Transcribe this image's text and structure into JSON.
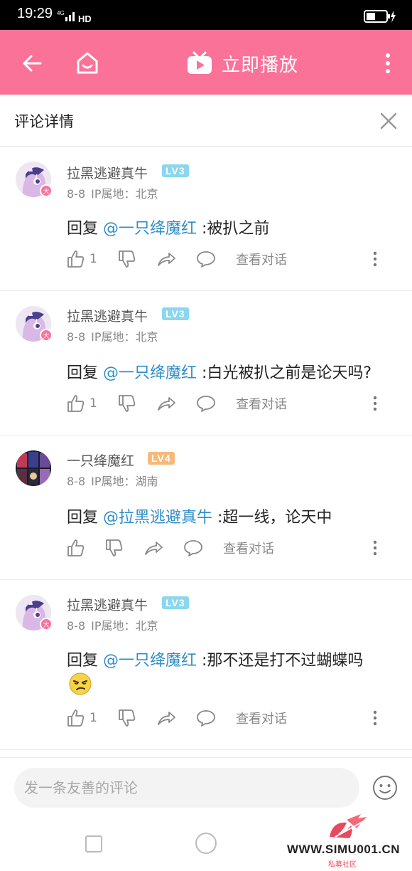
{
  "status_bar": {
    "time": "19:29",
    "network": "4G",
    "hd": "HD"
  },
  "header": {
    "play_label": "立即播放",
    "bg_color": "#fb7299"
  },
  "section": {
    "title": "评论详情"
  },
  "comments": [
    {
      "user": "拉黑逃避真牛",
      "level": "LV3",
      "date": "8-8",
      "ip": "IP属地：北京",
      "reply_prefix": "回复 ",
      "mention": "@一只绛魔红",
      "text": " :被扒之前",
      "likes": "1",
      "view_conversation": "查看对话"
    },
    {
      "user": "拉黑逃避真牛",
      "level": "LV3",
      "date": "8-8",
      "ip": "IP属地：北京",
      "reply_prefix": "回复 ",
      "mention": "@一只绛魔红",
      "text": " :白光被扒之前是论天吗?",
      "likes": "1",
      "view_conversation": "查看对话"
    },
    {
      "user": "一只绛魔红",
      "level": "LV4",
      "date": "8-8",
      "ip": "IP属地：湖南",
      "reply_prefix": "回复 ",
      "mention": "@拉黑逃避真牛",
      "text": " :超一线，论天中",
      "likes": "",
      "view_conversation": "查看对话"
    },
    {
      "user": "拉黑逃避真牛",
      "level": "LV3",
      "date": "8-8",
      "ip": "IP属地：北京",
      "reply_prefix": "回复 ",
      "mention": "@一只绛魔红",
      "text": " :那不还是打不过蝴蝶吗",
      "likes": "1",
      "view_conversation": "查看对话"
    }
  ],
  "input": {
    "placeholder": "发一条友善的评论"
  },
  "watermark": {
    "url": "WWW.SIMU001.CN",
    "sub": "私募社区"
  }
}
